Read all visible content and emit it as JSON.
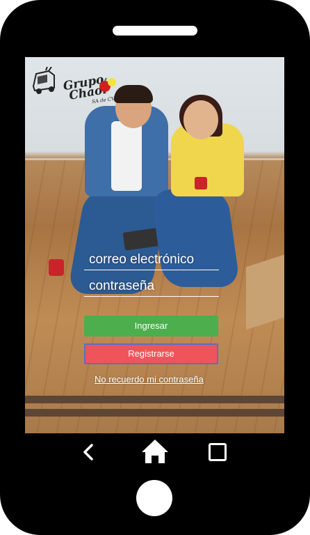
{
  "logo": {
    "name_line1": "Grupo",
    "name_line2": "Chaol",
    "tagline": "SA de CV"
  },
  "login": {
    "email_placeholder": "correo electrónico",
    "password_placeholder": "contraseña",
    "login_button": "Ingresar",
    "register_button": "Registrarse",
    "forgot_link": "No recuerdo mi contraseña"
  },
  "navigation": {
    "back_icon": "chevron-left-icon",
    "home_icon": "home-icon",
    "recent_icon": "square-icon"
  },
  "colors": {
    "login_button": "#4cae4c",
    "register_button": "#f0545a",
    "register_border": "#5470c8",
    "band": "#5e4637"
  }
}
